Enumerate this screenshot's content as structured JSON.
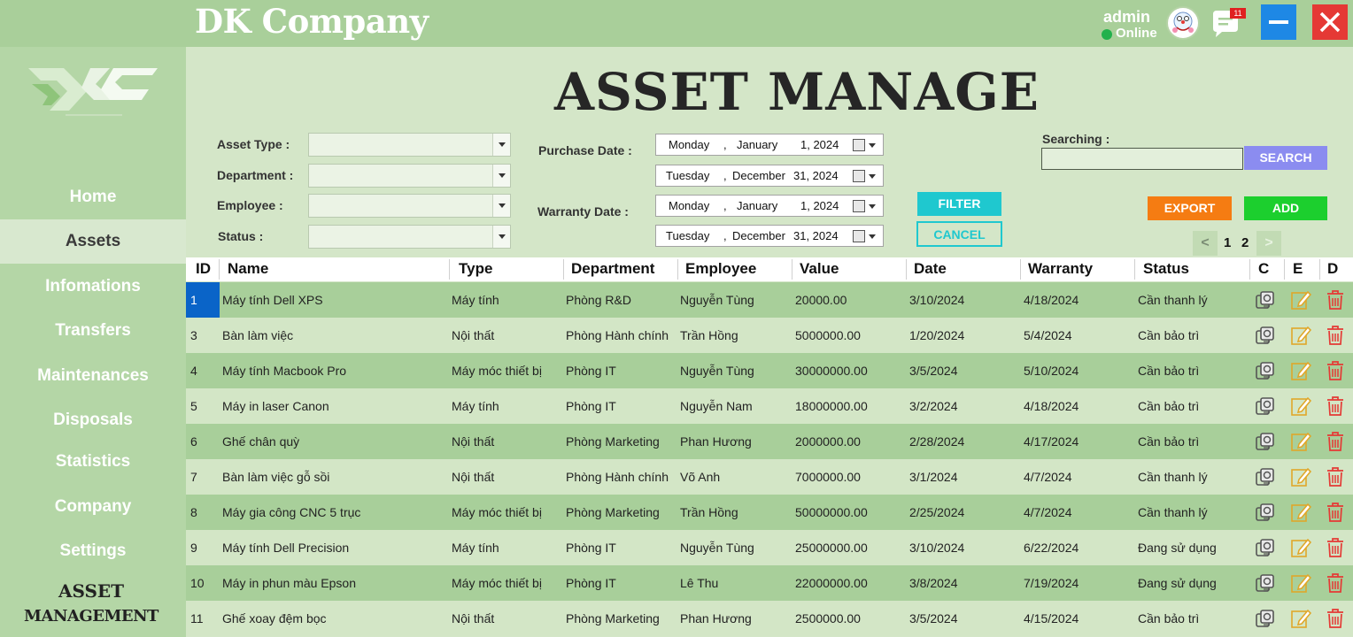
{
  "app": {
    "company_name": "DK Company",
    "page_title": "ASSET MANAGE"
  },
  "user": {
    "name": "admin",
    "status": "Online",
    "notifications": "11"
  },
  "sidebar": {
    "items": [
      {
        "label": "Home"
      },
      {
        "label": "Assets"
      },
      {
        "label": "Infomations"
      },
      {
        "label": "Transfers"
      },
      {
        "label": "Maintenances"
      },
      {
        "label": "Disposals"
      },
      {
        "label": "Statistics"
      },
      {
        "label": "Company"
      },
      {
        "label": "Settings"
      }
    ],
    "footer_line1": "ASSET",
    "footer_line2": "MANAGEMENT"
  },
  "filters": {
    "asset_type_label": "Asset Type :",
    "department_label": "Department :",
    "employee_label": "Employee :",
    "status_label": "Status :",
    "purchase_date_label": "Purchase Date :",
    "warranty_date_label": "Warranty Date :",
    "purchase_from": {
      "weekday": "Monday",
      "month": "January",
      "day": "1, 2024"
    },
    "purchase_to": {
      "weekday": "Tuesday",
      "month": "December",
      "day": "31, 2024"
    },
    "warranty_from": {
      "weekday": "Monday",
      "month": "January",
      "day": "1, 2024"
    },
    "warranty_to": {
      "weekday": "Tuesday",
      "month": "December",
      "day": "31, 2024"
    },
    "filter_label": "FILTER",
    "cancel_label": "CANCEL"
  },
  "search": {
    "label": "Searching :",
    "button": "SEARCH",
    "value": ""
  },
  "actions": {
    "export": "EXPORT",
    "add": "ADD"
  },
  "pagination": {
    "prev": "<",
    "next": ">",
    "pages": [
      "1",
      "2"
    ]
  },
  "table": {
    "columns": [
      "ID",
      "Name",
      "Type",
      "Department",
      "Employee",
      "Value",
      "Date",
      "Warranty",
      "Status",
      "C",
      "E",
      "D"
    ],
    "rows": [
      [
        "1",
        "Máy tính Dell XPS",
        "Máy tính",
        "Phòng R&D",
        "Nguyễn Tùng",
        "20000.00",
        "3/10/2024",
        "4/18/2024",
        "Cần thanh lý"
      ],
      [
        "3",
        "Bàn làm việc",
        "Nội thất",
        "Phòng Hành chính",
        "Trần Hồng",
        "5000000.00",
        "1/20/2024",
        "5/4/2024",
        "Cần bảo trì"
      ],
      [
        "4",
        "Máy tính Macbook Pro",
        "Máy móc thiết bị",
        "Phòng IT",
        "Nguyễn Tùng",
        "30000000.00",
        "3/5/2024",
        "5/10/2024",
        "Cần bảo trì"
      ],
      [
        "5",
        "Máy in laser Canon",
        "Máy tính",
        "Phòng IT",
        "Nguyễn Nam",
        "18000000.00",
        "3/2/2024",
        "4/18/2024",
        "Cần bảo trì"
      ],
      [
        "6",
        "Ghế chân quỳ",
        "Nội thất",
        "Phòng Marketing",
        "Phan Hương",
        "2000000.00",
        "2/28/2024",
        "4/17/2024",
        "Cần bảo trì"
      ],
      [
        "7",
        "Bàn làm việc gỗ sồi",
        "Nội thất",
        "Phòng Hành chính",
        "Võ Anh",
        "7000000.00",
        "3/1/2024",
        "4/7/2024",
        "Cần thanh lý"
      ],
      [
        "8",
        "Máy gia công CNC 5 trục",
        "Máy móc thiết bị",
        "Phòng Marketing",
        "Trần Hồng",
        "50000000.00",
        "2/25/2024",
        "4/7/2024",
        "Cần thanh lý"
      ],
      [
        "9",
        "Máy tính Dell Precision",
        "Máy tính",
        "Phòng IT",
        "Nguyễn Tùng",
        "25000000.00",
        "3/10/2024",
        "6/22/2024",
        "Đang sử dụng"
      ],
      [
        "10",
        "Máy in phun màu Epson",
        "Máy móc thiết bị",
        "Phòng IT",
        "Lê Thu",
        "22000000.00",
        "3/8/2024",
        "7/19/2024",
        "Đang sử dụng"
      ],
      [
        "11",
        "Ghế xoay đệm bọc",
        "Nội thất",
        "Phòng Marketing",
        "Phan Hương",
        "2500000.00",
        "3/5/2024",
        "4/15/2024",
        "Cần bảo trì"
      ]
    ]
  },
  "colors": {
    "accent_cyan": "#1fc8cf",
    "export": "#f57c12",
    "add": "#1ccf2e",
    "search": "#8b8cf0",
    "row_dark": "#a8cf9a",
    "row_light": "#d3e6c6"
  }
}
